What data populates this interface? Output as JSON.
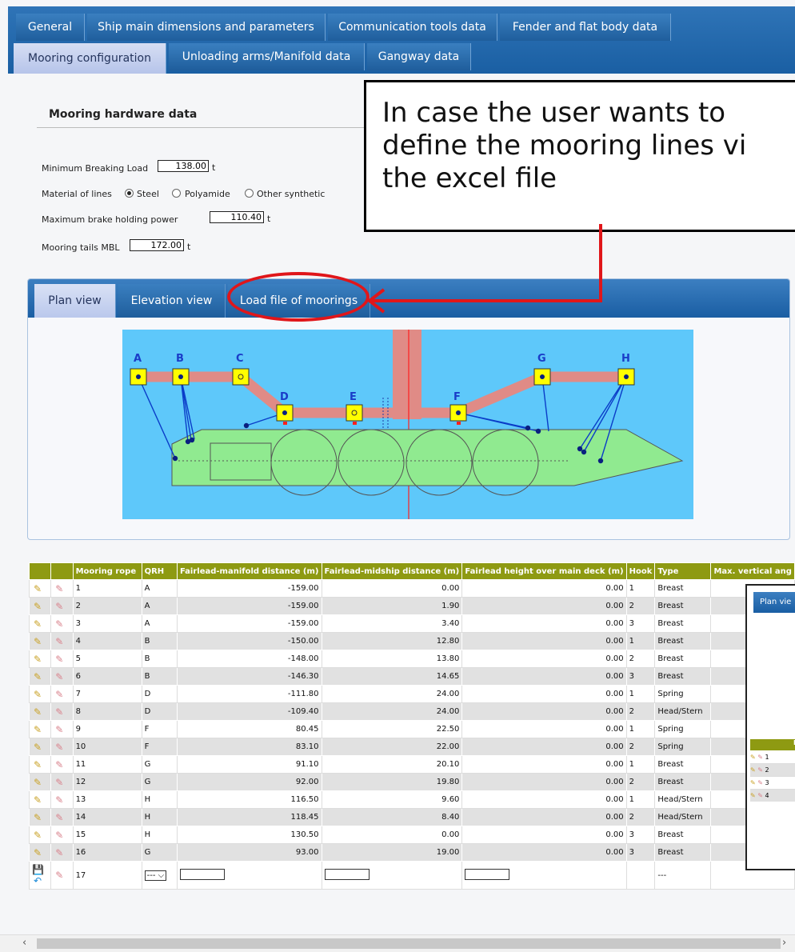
{
  "tabs_row1": [
    "General",
    "Ship main dimensions and parameters",
    "Communication tools data",
    "Fender and flat body data"
  ],
  "tabs_row2": [
    "Mooring configuration",
    "Unloading arms/Manifold data",
    "Gangway data"
  ],
  "section": {
    "title": "Mooring hardware data"
  },
  "mbl": {
    "label": "Minimum Breaking Load",
    "value": "138.00",
    "unit": "t"
  },
  "material": {
    "label": "Material of lines",
    "options": [
      "Steel",
      "Polyamide",
      "Other synthetic"
    ],
    "selected": "Steel"
  },
  "brake": {
    "label": "Maximum brake holding power",
    "value": "110.40",
    "unit": "t"
  },
  "tails": {
    "label": "Mooring tails MBL",
    "value": "172.00",
    "unit": "t"
  },
  "callout": {
    "line1": "In case the user wants to",
    "line2": "define the mooring lines vi",
    "line3": "the excel file"
  },
  "view_tabs": [
    "Plan view",
    "Elevation view",
    "Load file of moorings"
  ],
  "diagram": {
    "letters": [
      "A",
      "B",
      "C",
      "D",
      "E",
      "F",
      "G",
      "H"
    ]
  },
  "table": {
    "headers": [
      "Mooring rope",
      "QRH",
      "Fairlead-manifold distance (m)",
      "Fairlead-midship distance (m)",
      "Fairlead height over main deck (m)",
      "Hook",
      "Type",
      "Max. vertical ang"
    ],
    "rows": [
      [
        "1",
        "A",
        "-159.00",
        "0.00",
        "0.00",
        "1",
        "Breast"
      ],
      [
        "2",
        "A",
        "-159.00",
        "1.90",
        "0.00",
        "2",
        "Breast"
      ],
      [
        "3",
        "A",
        "-159.00",
        "3.40",
        "0.00",
        "3",
        "Breast"
      ],
      [
        "4",
        "B",
        "-150.00",
        "12.80",
        "0.00",
        "1",
        "Breast"
      ],
      [
        "5",
        "B",
        "-148.00",
        "13.80",
        "0.00",
        "2",
        "Breast"
      ],
      [
        "6",
        "B",
        "-146.30",
        "14.65",
        "0.00",
        "3",
        "Breast"
      ],
      [
        "7",
        "D",
        "-111.80",
        "24.00",
        "0.00",
        "1",
        "Spring"
      ],
      [
        "8",
        "D",
        "-109.40",
        "24.00",
        "0.00",
        "2",
        "Head/Stern"
      ],
      [
        "9",
        "F",
        "80.45",
        "22.50",
        "0.00",
        "1",
        "Spring"
      ],
      [
        "10",
        "F",
        "83.10",
        "22.00",
        "0.00",
        "2",
        "Spring"
      ],
      [
        "11",
        "G",
        "91.10",
        "20.10",
        "0.00",
        "1",
        "Breast"
      ],
      [
        "12",
        "G",
        "92.00",
        "19.80",
        "0.00",
        "2",
        "Breast"
      ],
      [
        "13",
        "H",
        "116.50",
        "9.60",
        "0.00",
        "1",
        "Head/Stern"
      ],
      [
        "14",
        "H",
        "118.45",
        "8.40",
        "0.00",
        "2",
        "Head/Stern"
      ],
      [
        "15",
        "H",
        "130.50",
        "0.00",
        "0.00",
        "3",
        "Breast"
      ],
      [
        "16",
        "G",
        "93.00",
        "19.00",
        "0.00",
        "3",
        "Breast"
      ]
    ],
    "new_row": {
      "rope": "17",
      "qrh": "---",
      "type": "---"
    }
  },
  "subpanel": {
    "tab": "Plan vie",
    "header": "M",
    "rows": [
      "1",
      "2",
      "3",
      "4"
    ]
  }
}
